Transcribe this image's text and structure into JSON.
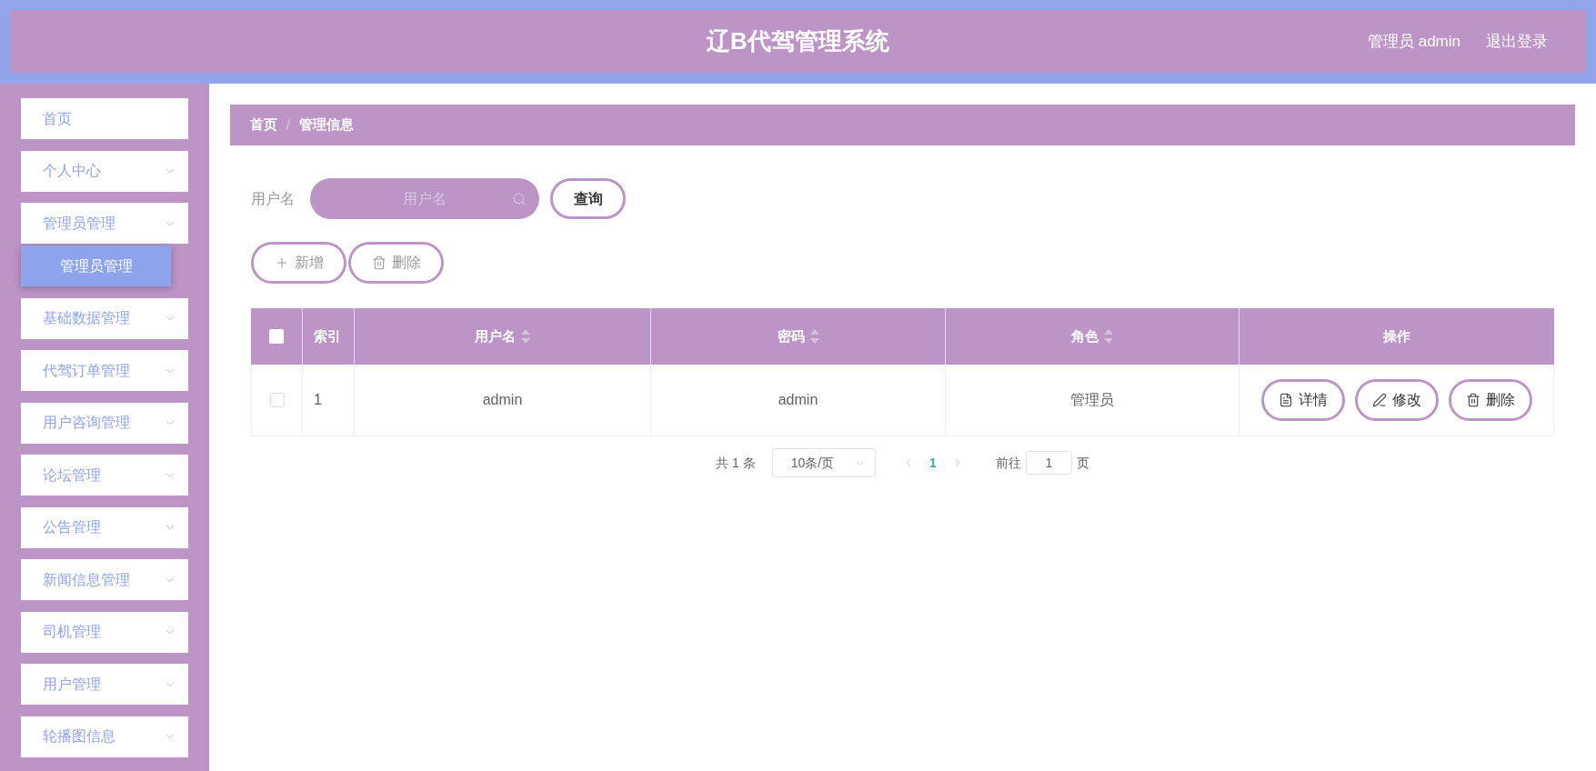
{
  "header": {
    "title": "辽B代驾管理系统",
    "user": "管理员 admin",
    "logout": "退出登录"
  },
  "sidebar": {
    "items": [
      {
        "kind": "link",
        "label": "首页"
      },
      {
        "kind": "submenu",
        "label": "个人中心"
      },
      {
        "kind": "submenu",
        "label": "管理员管理",
        "children": [
          {
            "label": "管理员管理",
            "selected": true
          }
        ]
      },
      {
        "kind": "submenu",
        "label": "基础数据管理"
      },
      {
        "kind": "submenu",
        "label": "代驾订单管理"
      },
      {
        "kind": "submenu",
        "label": "用户咨询管理"
      },
      {
        "kind": "submenu",
        "label": "论坛管理"
      },
      {
        "kind": "submenu",
        "label": "公告管理"
      },
      {
        "kind": "submenu",
        "label": "新闻信息管理"
      },
      {
        "kind": "submenu",
        "label": "司机管理"
      },
      {
        "kind": "submenu",
        "label": "用户管理"
      },
      {
        "kind": "submenu",
        "label": "轮播图信息"
      }
    ]
  },
  "breadcrumb": {
    "items": [
      "首页",
      "管理信息"
    ],
    "separator": "/"
  },
  "search": {
    "label": "用户名",
    "placeholder": "用户名",
    "button": "查询"
  },
  "toolbar": [
    {
      "kind": "add",
      "label": "新增"
    },
    {
      "kind": "delete",
      "label": "删除"
    }
  ],
  "table": {
    "select_all": {
      "checked": false
    },
    "columns": [
      {
        "label": "索引",
        "sortable": false
      },
      {
        "label": "用户名",
        "sortable": true
      },
      {
        "label": "密码",
        "sortable": true
      },
      {
        "label": "角色",
        "sortable": true
      },
      {
        "label": "操作",
        "sortable": false
      }
    ],
    "rows": [
      {
        "checked": false,
        "cells": [
          "1",
          "admin",
          "admin",
          "管理员"
        ],
        "actions": [
          {
            "kind": "detail",
            "label": "详情"
          },
          {
            "kind": "edit",
            "label": "修改"
          },
          {
            "kind": "delete",
            "label": "删除"
          }
        ]
      }
    ]
  },
  "pagination": {
    "total": "共 1 条",
    "page_size": "10条/页",
    "prev_disabled": true,
    "pages": [
      {
        "label": "1",
        "selected": true
      }
    ],
    "next_disabled": true,
    "goto_label": "前往",
    "goto_value": "1",
    "goto_suffix": "页"
  }
}
